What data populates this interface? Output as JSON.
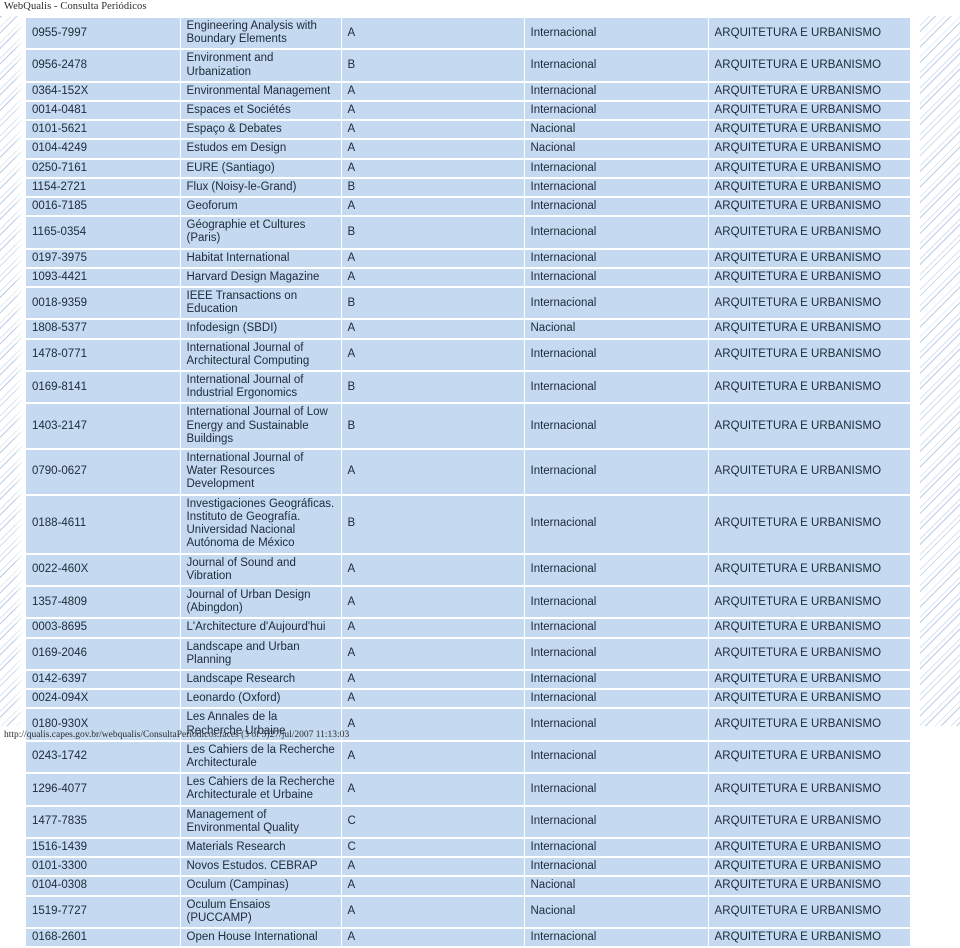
{
  "page": {
    "header_title": "WebQualis - Consulta Periódicos",
    "footer_text": "http://qualis.capes.gov.br/webqualis/ConsultaPeriodicos.faces (3 of 5)27/jul/2007 11:13:03",
    "row_background": "#c5daf0",
    "text_color": "#1c2a3a"
  },
  "table": {
    "rows": [
      {
        "issn": "0955-7997",
        "title": "Engineering Analysis with Boundary Elements",
        "grade": "A",
        "scope": "Internacional",
        "area": "ARQUITETURA E URBANISMO"
      },
      {
        "issn": "0956-2478",
        "title": "Environment and Urbanization",
        "grade": "B",
        "scope": "Internacional",
        "area": "ARQUITETURA E URBANISMO"
      },
      {
        "issn": "0364-152X",
        "title": "Environmental Management",
        "grade": "A",
        "scope": "Internacional",
        "area": "ARQUITETURA E URBANISMO"
      },
      {
        "issn": "0014-0481",
        "title": "Espaces et Sociétés",
        "grade": "A",
        "scope": "Internacional",
        "area": "ARQUITETURA E URBANISMO"
      },
      {
        "issn": "0101-5621",
        "title": "Espaço & Debates",
        "grade": "A",
        "scope": "Nacional",
        "area": "ARQUITETURA E URBANISMO"
      },
      {
        "issn": "0104-4249",
        "title": "Estudos em Design",
        "grade": "A",
        "scope": "Nacional",
        "area": "ARQUITETURA E URBANISMO"
      },
      {
        "issn": "0250-7161",
        "title": "EURE (Santiago)",
        "grade": "A",
        "scope": "Internacional",
        "area": "ARQUITETURA E URBANISMO"
      },
      {
        "issn": "1154-2721",
        "title": "Flux (Noisy-le-Grand)",
        "grade": "B",
        "scope": "Internacional",
        "area": "ARQUITETURA E URBANISMO"
      },
      {
        "issn": "0016-7185",
        "title": "Geoforum",
        "grade": "A",
        "scope": "Internacional",
        "area": "ARQUITETURA E URBANISMO"
      },
      {
        "issn": "1165-0354",
        "title": "Géographie et Cultures (Paris)",
        "grade": "B",
        "scope": "Internacional",
        "area": "ARQUITETURA E URBANISMO"
      },
      {
        "issn": "0197-3975",
        "title": "Habitat International",
        "grade": "A",
        "scope": "Internacional",
        "area": "ARQUITETURA E URBANISMO"
      },
      {
        "issn": "1093-4421",
        "title": "Harvard Design Magazine",
        "grade": "A",
        "scope": "Internacional",
        "area": "ARQUITETURA E URBANISMO"
      },
      {
        "issn": "0018-9359",
        "title": "IEEE Transactions on Education",
        "grade": "B",
        "scope": "Internacional",
        "area": "ARQUITETURA E URBANISMO"
      },
      {
        "issn": "1808-5377",
        "title": "Infodesign (SBDI)",
        "grade": "A",
        "scope": "Nacional",
        "area": "ARQUITETURA E URBANISMO"
      },
      {
        "issn": "1478-0771",
        "title": "International Journal of Architectural Computing",
        "grade": "A",
        "scope": "Internacional",
        "area": "ARQUITETURA E URBANISMO"
      },
      {
        "issn": "0169-8141",
        "title": "International Journal of Industrial Ergonomics",
        "grade": "B",
        "scope": "Internacional",
        "area": "ARQUITETURA E URBANISMO"
      },
      {
        "issn": "1403-2147",
        "title": "International Journal of Low Energy and Sustainable Buildings",
        "grade": "B",
        "scope": "Internacional",
        "area": "ARQUITETURA E URBANISMO"
      },
      {
        "issn": "0790-0627",
        "title": "International Journal of Water Resources Development",
        "grade": "A",
        "scope": "Internacional",
        "area": "ARQUITETURA E URBANISMO"
      },
      {
        "issn": "0188-4611",
        "title": "Investigaciones Geográficas. Instituto de Geografía. Universidad Nacional Autónoma de México",
        "grade": "B",
        "scope": "Internacional",
        "area": "ARQUITETURA E URBANISMO"
      },
      {
        "issn": "0022-460X",
        "title": "Journal of Sound and Vibration",
        "grade": "A",
        "scope": "Internacional",
        "area": "ARQUITETURA E URBANISMO"
      },
      {
        "issn": "1357-4809",
        "title": "Journal of Urban Design (Abingdon)",
        "grade": "A",
        "scope": "Internacional",
        "area": "ARQUITETURA E URBANISMO"
      },
      {
        "issn": "0003-8695",
        "title": "L'Architecture d'Aujourd'hui",
        "grade": "A",
        "scope": "Internacional",
        "area": "ARQUITETURA E URBANISMO"
      },
      {
        "issn": "0169-2046",
        "title": "Landscape and Urban Planning",
        "grade": "A",
        "scope": "Internacional",
        "area": "ARQUITETURA E URBANISMO"
      },
      {
        "issn": "0142-6397",
        "title": "Landscape Research",
        "grade": "A",
        "scope": "Internacional",
        "area": "ARQUITETURA E URBANISMO"
      },
      {
        "issn": "0024-094X",
        "title": "Leonardo (Oxford)",
        "grade": "A",
        "scope": "Internacional",
        "area": "ARQUITETURA E URBANISMO"
      },
      {
        "issn": "0180-930X",
        "title": "Les Annales de la Recherche Urbaine",
        "grade": "A",
        "scope": "Internacional",
        "area": "ARQUITETURA E URBANISMO"
      },
      {
        "issn": "0243-1742",
        "title": "Les Cahiers de la Recherche Architecturale",
        "grade": "A",
        "scope": "Internacional",
        "area": "ARQUITETURA E URBANISMO"
      },
      {
        "issn": "1296-4077",
        "title": "Les Cahiers de la Recherche Architecturale et Urbaine",
        "grade": "A",
        "scope": "Internacional",
        "area": "ARQUITETURA E URBANISMO"
      },
      {
        "issn": "1477-7835",
        "title": "Management of Environmental Quality",
        "grade": "C",
        "scope": "Internacional",
        "area": "ARQUITETURA E URBANISMO"
      },
      {
        "issn": "1516-1439",
        "title": "Materials Research",
        "grade": "C",
        "scope": "Internacional",
        "area": "ARQUITETURA E URBANISMO"
      },
      {
        "issn": "0101-3300",
        "title": "Novos Estudos. CEBRAP",
        "grade": "A",
        "scope": "Internacional",
        "area": "ARQUITETURA E URBANISMO"
      },
      {
        "issn": "0104-0308",
        "title": "Oculum (Campinas)",
        "grade": "A",
        "scope": "Nacional",
        "area": "ARQUITETURA E URBANISMO"
      },
      {
        "issn": "1519-7727",
        "title": "Oculum Ensaios (PUCCAMP)",
        "grade": "A",
        "scope": "Nacional",
        "area": "ARQUITETURA E URBANISMO"
      },
      {
        "issn": "0168-2601",
        "title": "Open House International",
        "grade": "A",
        "scope": "Internacional",
        "area": "ARQUITETURA E URBANISMO"
      }
    ]
  }
}
